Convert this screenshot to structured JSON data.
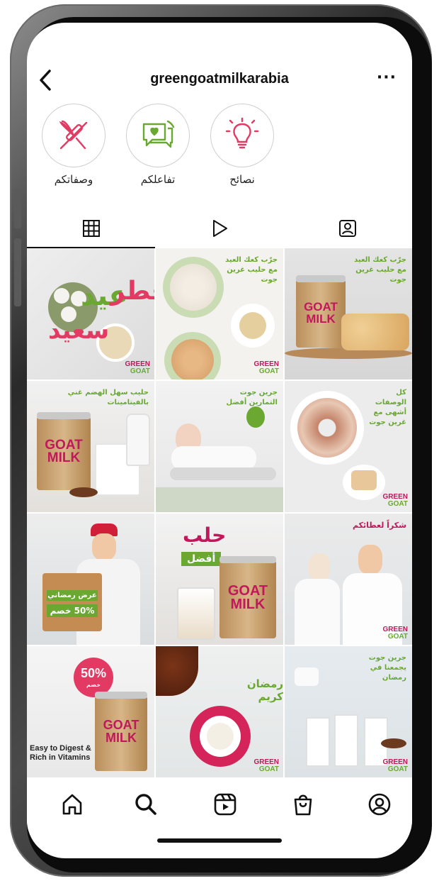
{
  "header": {
    "username": "greengoatmilkarabia",
    "more_label": "···"
  },
  "highlights": [
    {
      "label": "وصفاتكم",
      "icon": "whisk-rolling-pin-icon"
    },
    {
      "label": "تفاعلكم",
      "icon": "chat-heart-icon"
    },
    {
      "label": "نصائح",
      "icon": "lightbulb-icon"
    }
  ],
  "tabs": [
    {
      "name": "grid-tab",
      "icon": "grid-icon",
      "active": true
    },
    {
      "name": "reels-tab",
      "icon": "play-icon",
      "active": false
    },
    {
      "name": "tagged-tab",
      "icon": "tagged-person-icon",
      "active": false
    }
  ],
  "posts": {
    "p1": {
      "title_a": "عيد",
      "title_b": "فطر",
      "title_c": "سعيد"
    },
    "p2": {
      "caption": "جرّب كعك العيد مع حليب غرين جوت"
    },
    "p3": {
      "caption": "جرّب كعك العيد مع حليب غرين جوت",
      "can": "GOAT MILK"
    },
    "p4": {
      "caption": "حليب سهل الهضم غني بالفيتامينات",
      "can": "GOAT MILK"
    },
    "p5": {
      "caption": "جرين جوت التمارين أفضل"
    },
    "p6": {
      "caption": "كل الوصفات أشهى مع غرين جوت"
    },
    "p7": {
      "badge_title": "عرض رمضاني",
      "badge_sub": "50% خصم"
    },
    "p8": {
      "word_a": "حلب",
      "word_b": "أفضل",
      "can": "GOAT MILK"
    },
    "p9": {
      "caption": "شكراً لعطائكم"
    },
    "p10": {
      "badge": "50%",
      "badge_sub": "خصم",
      "can": "GOAT MILK",
      "tag_line1": "Easy to Digest &",
      "tag_line2": "Rich in Vitamins"
    },
    "p11": {
      "script": "رمضان كريم"
    },
    "p12": {
      "caption": "جرين جوت يجمعنا في رمضان"
    },
    "brand_line1": "GREEN",
    "brand_line2": "GOAT"
  },
  "nav": [
    {
      "name": "home",
      "icon": "home-icon"
    },
    {
      "name": "search",
      "icon": "search-icon"
    },
    {
      "name": "reels",
      "icon": "reels-icon"
    },
    {
      "name": "shop",
      "icon": "shopping-bag-icon"
    },
    {
      "name": "profile",
      "icon": "profile-icon"
    }
  ],
  "colors": {
    "brand_pink": "#c0185b",
    "brand_green": "#6aa832",
    "accent": "#111111"
  }
}
